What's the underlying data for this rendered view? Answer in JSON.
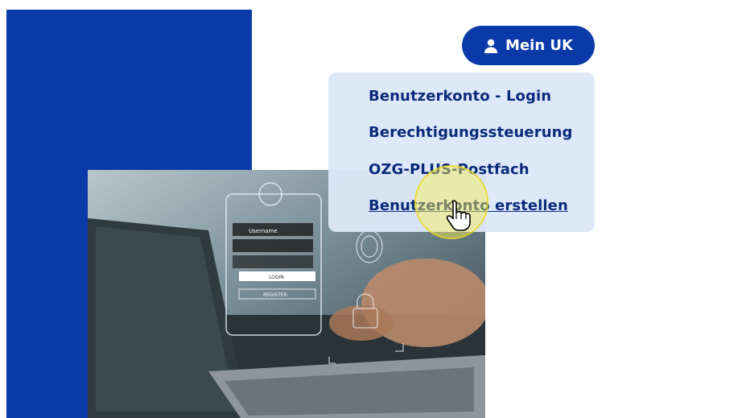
{
  "header": {
    "account_button_label": "Mein UK",
    "account_icon": "user-icon"
  },
  "account_menu": {
    "items": [
      {
        "label": "Benutzerkonto - Login"
      },
      {
        "label": "Berechtigungssteuerung"
      },
      {
        "label": "OZG-PLUS-Postfach"
      },
      {
        "label": "Benutzerkonto erstellen"
      }
    ]
  },
  "hero_image": {
    "username_placeholder": "Username",
    "login_label": "LOGIN",
    "register_label": "REGISTER"
  },
  "colors": {
    "brand_blue": "#0a3aa8",
    "menu_background": "#dce7f8",
    "menu_text": "#0a2a7a"
  }
}
